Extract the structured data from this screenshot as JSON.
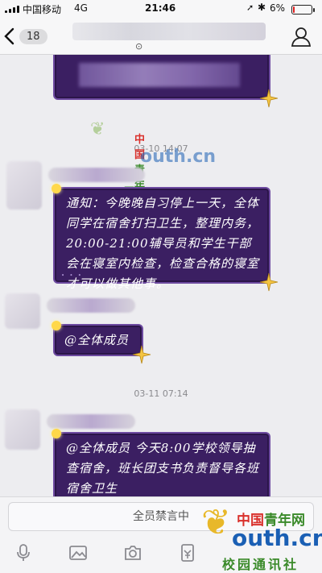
{
  "status_bar": {
    "carrier": "中国移动",
    "network": "4G",
    "time": "21:46",
    "battery": "6%",
    "battery_level": 0.06
  },
  "nav": {
    "unread_count": "18",
    "chevron": "⊙"
  },
  "messages": {
    "time_1": "03-10 14:07",
    "notice_text": "通知：今晚晚自习停上一天，全体同学在宿舍打扫卫生，整理内务，20:00-21:00辅导员和学生干部会在寝室内检查，检查合格的寝室才可以做其他事。",
    "at_all_text": "@全体成员",
    "time_2": "03-11 07:14",
    "notice_2_text": "@全体成员 今天8:00学校领导抽查宿舍，班长团支书负责督导各班宿舍卫生"
  },
  "input": {
    "mute_placeholder": "全员禁言中"
  },
  "watermark": {
    "cn_red": "中国",
    "cn_green": "青年网",
    "domain": "outh.cn",
    "sub": "校园通讯社"
  },
  "colors": {
    "bubble_bg": "#3b1f62",
    "bubble_border": "#6d4aa0",
    "accent_gold": "#ffd84a"
  }
}
